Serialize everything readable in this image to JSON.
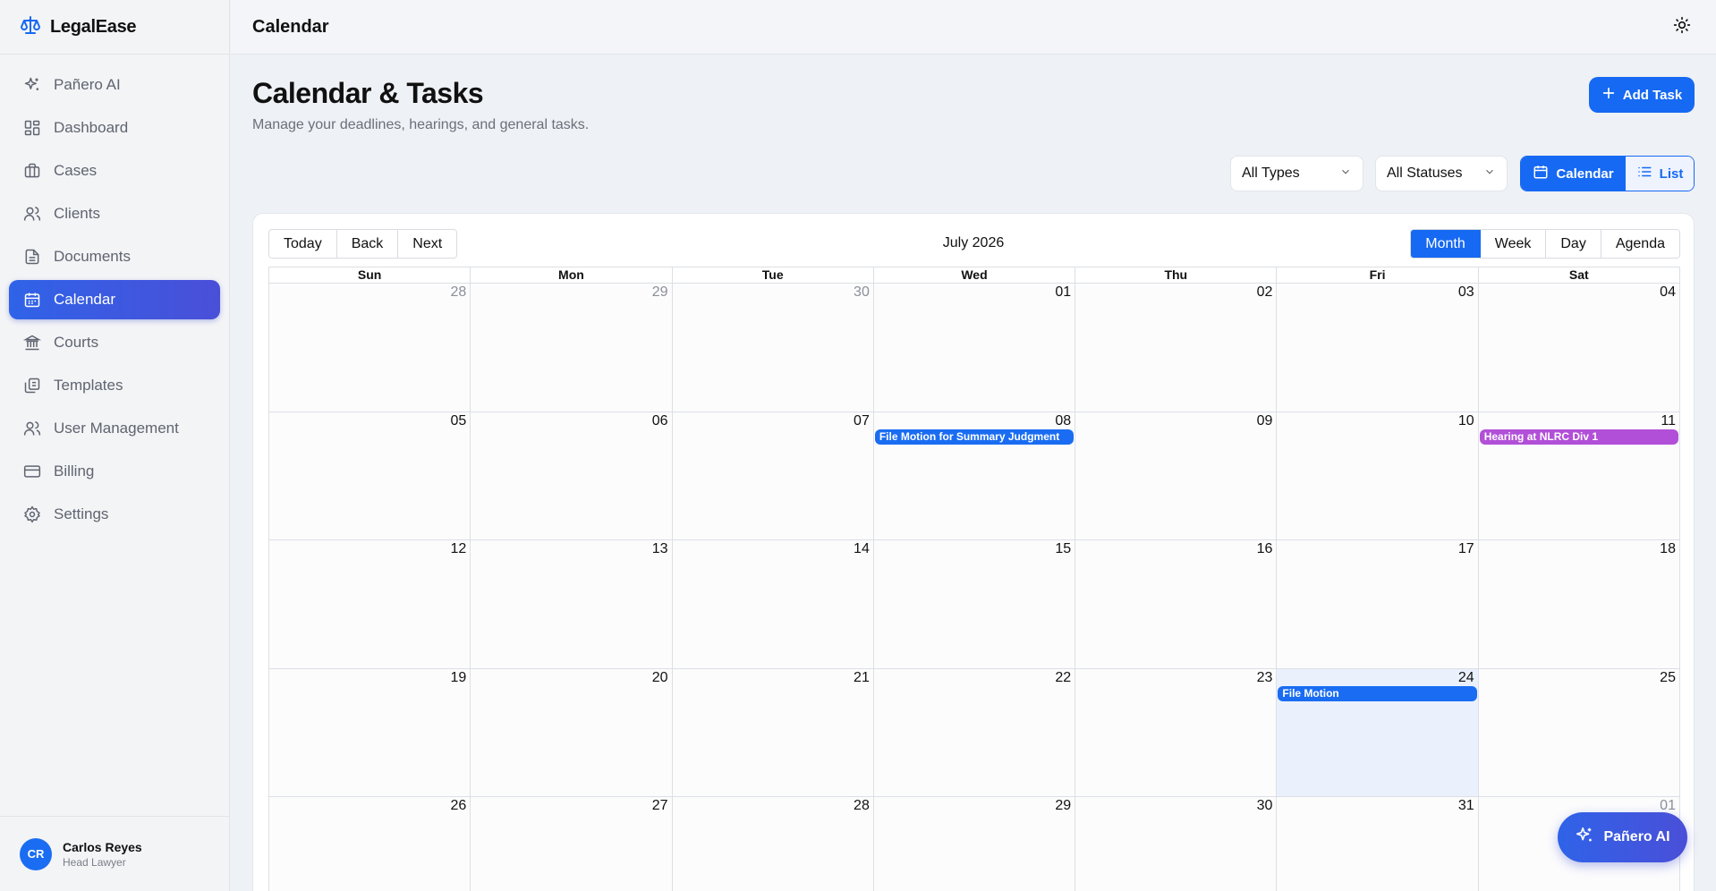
{
  "app": {
    "name": "LegalEase"
  },
  "sidebar": {
    "items": [
      {
        "label": "Pañero AI",
        "icon": "sparkles-icon",
        "active": false
      },
      {
        "label": "Dashboard",
        "icon": "dashboard-icon",
        "active": false
      },
      {
        "label": "Cases",
        "icon": "briefcase-icon",
        "active": false
      },
      {
        "label": "Clients",
        "icon": "users-icon",
        "active": false
      },
      {
        "label": "Documents",
        "icon": "document-icon",
        "active": false
      },
      {
        "label": "Calendar",
        "icon": "calendar-icon",
        "active": true
      },
      {
        "label": "Courts",
        "icon": "courthouse-icon",
        "active": false
      },
      {
        "label": "Templates",
        "icon": "templates-icon",
        "active": false
      },
      {
        "label": "User Management",
        "icon": "user-management-icon",
        "active": false
      },
      {
        "label": "Billing",
        "icon": "credit-card-icon",
        "active": false
      },
      {
        "label": "Settings",
        "icon": "gear-icon",
        "active": false
      }
    ],
    "user": {
      "initials": "CR",
      "name": "Carlos Reyes",
      "role": "Head Lawyer"
    }
  },
  "topbar": {
    "title": "Calendar"
  },
  "header": {
    "title": "Calendar & Tasks",
    "subtitle": "Manage your deadlines, hearings, and general tasks.",
    "add_label": "Add Task"
  },
  "filters": {
    "types": "All Types",
    "statuses": "All Statuses"
  },
  "view_toggle": {
    "calendar": "Calendar",
    "list": "List"
  },
  "calendar": {
    "nav": {
      "today": "Today",
      "back": "Back",
      "next": "Next"
    },
    "month_label": "July 2026",
    "views": {
      "month": "Month",
      "week": "Week",
      "day": "Day",
      "agenda": "Agenda"
    },
    "active_view": "Month",
    "weekdays": [
      "Sun",
      "Mon",
      "Tue",
      "Wed",
      "Thu",
      "Fri",
      "Sat"
    ],
    "weeks": [
      [
        "28",
        "29",
        "30",
        "01",
        "02",
        "03",
        "04"
      ],
      [
        "05",
        "06",
        "07",
        "08",
        "09",
        "10",
        "11"
      ],
      [
        "12",
        "13",
        "14",
        "15",
        "16",
        "17",
        "18"
      ],
      [
        "19",
        "20",
        "21",
        "22",
        "23",
        "24",
        "25"
      ],
      [
        "26",
        "27",
        "28",
        "29",
        "30",
        "31",
        "01"
      ]
    ],
    "events": [
      {
        "title": "File Motion for Summary Judgment",
        "week": 1,
        "day": 3,
        "color": "#1a6df2"
      },
      {
        "title": "Hearing at NLRC Div 1",
        "week": 1,
        "day": 6,
        "color": "#b24fd8"
      },
      {
        "title": "File Motion",
        "week": 3,
        "day": 5,
        "color": "#1a6df2"
      }
    ]
  },
  "fab": {
    "label": "Pañero AI"
  }
}
